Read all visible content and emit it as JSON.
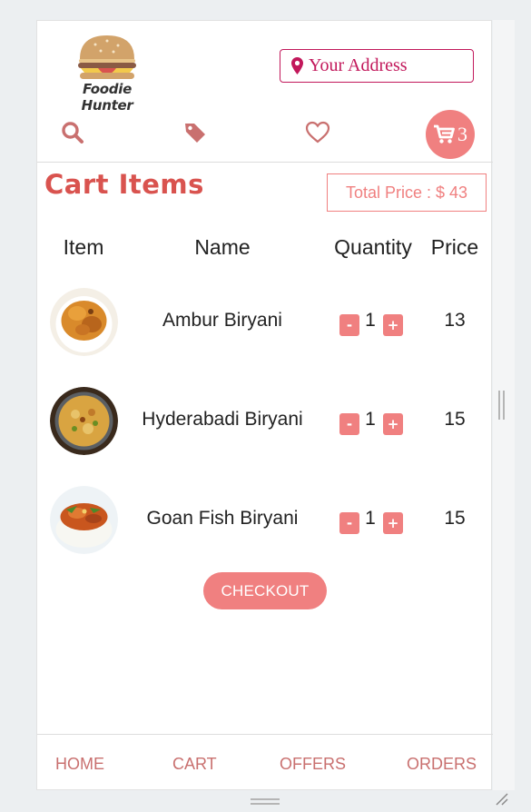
{
  "brand": {
    "name": "Foodie Hunter"
  },
  "header": {
    "address_placeholder": "Your Address",
    "cart_count": "3"
  },
  "icons": {
    "search": "search-icon",
    "offers": "tag-icon",
    "favorites": "heart-icon",
    "cart": "cart-icon",
    "address": "map-marker-icon"
  },
  "cart": {
    "title": "Cart Items",
    "total_label": "Total Price : $ 43",
    "columns": [
      "Item",
      "Name",
      "Quantity",
      "Price"
    ],
    "rows": [
      {
        "name": "Ambur Biryani",
        "minus": "-",
        "qty": "1",
        "plus": "+",
        "price": "13"
      },
      {
        "name": "Hyderabadi Biryani",
        "minus": "-",
        "qty": "1",
        "plus": "+",
        "price": "15"
      },
      {
        "name": "Goan Fish Biryani",
        "minus": "-",
        "qty": "1",
        "plus": "+",
        "price": "15"
      }
    ],
    "checkout_label": "CHECKOUT"
  },
  "footer": {
    "items": [
      "HOME",
      "CART",
      "OFFERS",
      "ORDERS"
    ]
  },
  "colors": {
    "accent": "#f08080",
    "title": "#d9534f",
    "address": "#c2185b",
    "footer_text": "#c9706f"
  }
}
